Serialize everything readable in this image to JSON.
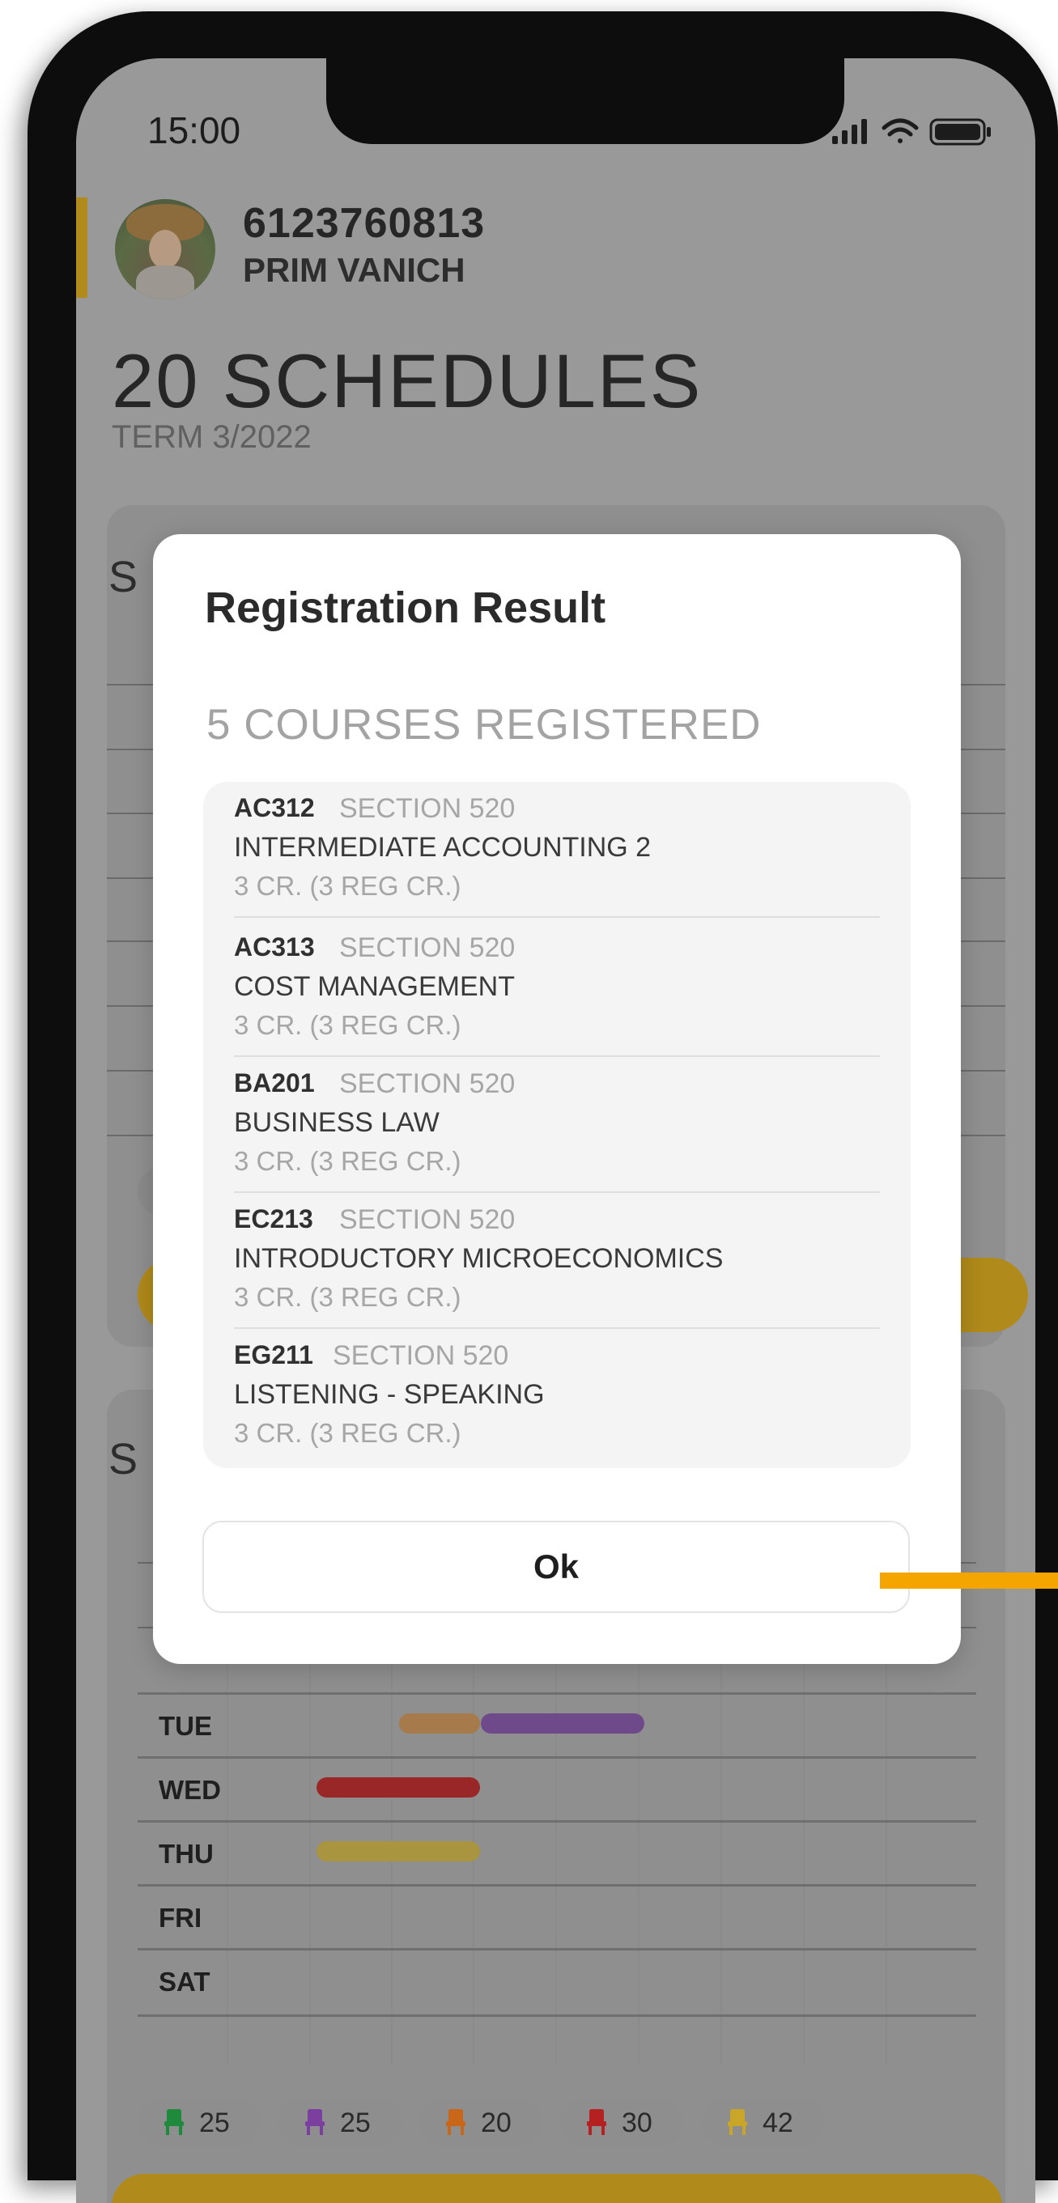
{
  "status_bar": {
    "time": "15:00"
  },
  "profile": {
    "student_id": "6123760813",
    "name": "PRIM VANICH"
  },
  "page": {
    "title": "20 SCHEDULES",
    "term": "TERM 3/2022"
  },
  "schedule": {
    "days": [
      "TUE",
      "WED",
      "THU",
      "FRI",
      "SAT"
    ],
    "seat_legend": [
      {
        "color": "#1f8a3c",
        "count": "25"
      },
      {
        "color": "#7b3fa0",
        "count": "25"
      },
      {
        "color": "#c8661a",
        "count": "20"
      },
      {
        "color": "#b52020",
        "count": "30"
      },
      {
        "color": "#c9a528",
        "count": "42"
      }
    ]
  },
  "modal": {
    "title": "Registration Result",
    "subtitle": "5 COURSES REGISTERED",
    "courses": [
      {
        "code": "AC312",
        "section": "SECTION 520",
        "name": "INTERMEDIATE ACCOUNTING 2",
        "credit": "3 CR. (3 REG CR.)"
      },
      {
        "code": "AC313",
        "section": "SECTION 520",
        "name": "COST MANAGEMENT",
        "credit": "3 CR. (3 REG CR.)"
      },
      {
        "code": "BA201",
        "section": "SECTION 520",
        "name": "BUSINESS LAW",
        "credit": "3 CR. (3 REG CR.)"
      },
      {
        "code": "EC213",
        "section": "SECTION 520",
        "name": "INTRODUCTORY MICROECONOMICS",
        "credit": "3 CR. (3 REG CR.)"
      },
      {
        "code": "EG211",
        "section": "SECTION 520",
        "name": "LISTENING - SPEAKING",
        "credit": "3 CR. (3 REG CR.)"
      }
    ],
    "ok_label": "Ok"
  }
}
